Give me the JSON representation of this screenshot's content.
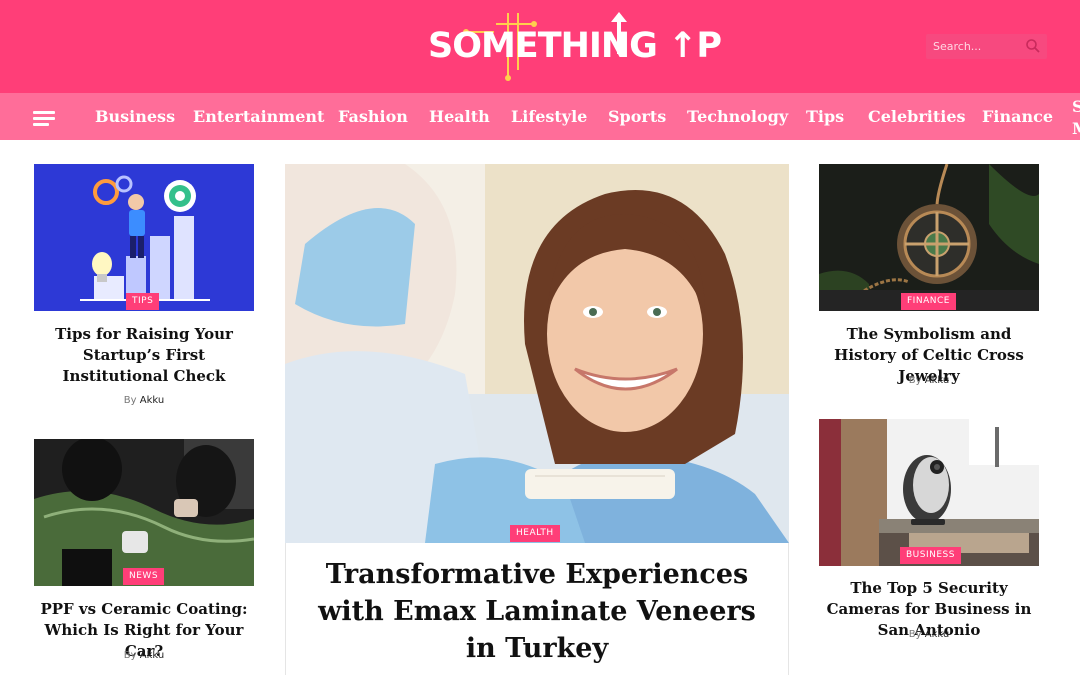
{
  "header": {
    "logo_text_main": "SOME",
    "logo_text_t": "T",
    "logo_text_rest": "HING ",
    "logo_text_up": "↑P",
    "search_placeholder": "Search...",
    "brand_color": "#ff3e78",
    "nav_color": "#ff6d99"
  },
  "nav": {
    "items": [
      "Business",
      "Entertainment",
      "Fashion",
      "Health",
      "Lifestyle",
      "Sports",
      "Technology",
      "Tips",
      "Celebrities",
      "Finance"
    ],
    "cut_item_line1": "S",
    "cut_item_line2": "M"
  },
  "left_column": [
    {
      "category": "TIPS",
      "title": "Tips for Raising Your Startup’s First Institutional Check",
      "by": "By",
      "author": "Akku",
      "icon": "business-illustration"
    },
    {
      "category": "NEWS",
      "title": "PPF vs Ceramic Coating: Which Is Right for Your Car?",
      "by": "By",
      "author": "Akku",
      "icon": "car-wrap-photo"
    }
  ],
  "hero": {
    "category": "HEALTH",
    "title": "Transformative Experiences with Emax Laminate Veneers in Turkey",
    "icon": "dental-patient-photo"
  },
  "right_column": [
    {
      "category": "FINANCE",
      "title": "The Symbolism and History of Celtic Cross Jewelry",
      "by": "By",
      "author": "Akku",
      "icon": "celtic-pendant-photo"
    },
    {
      "category": "BUSINESS",
      "title": "The Top 5 Security Cameras for Business in San Antonio",
      "by": "By",
      "author": "Akku",
      "icon": "security-camera-photo"
    }
  ]
}
